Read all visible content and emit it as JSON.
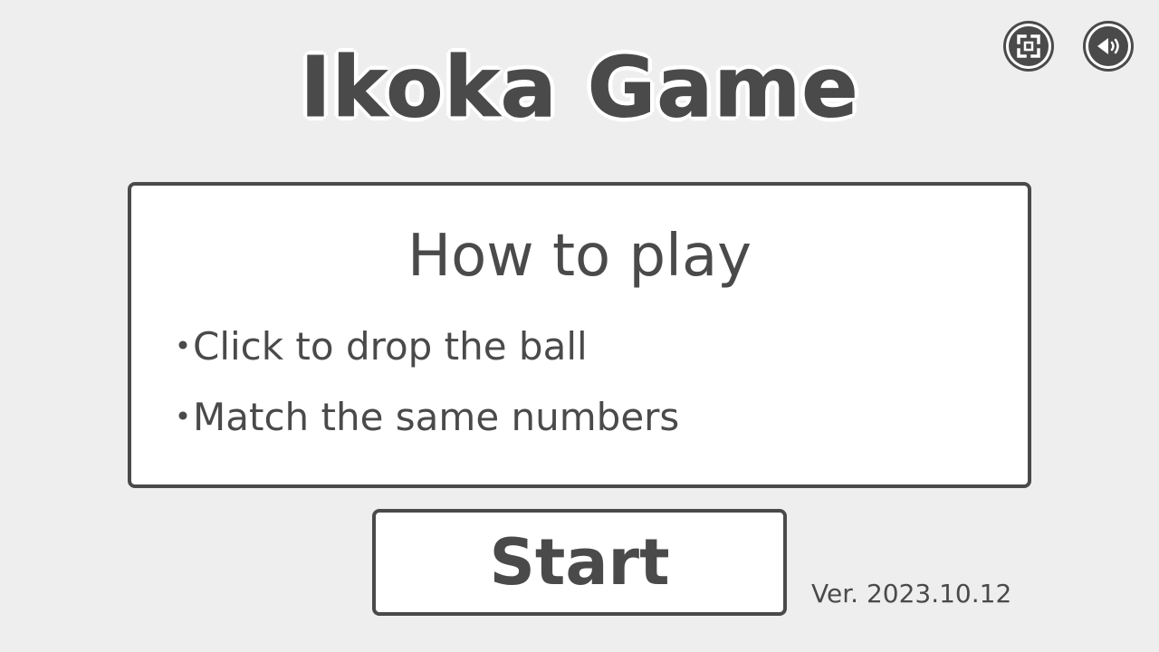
{
  "game": {
    "title": "Ikoka Game"
  },
  "controls": {
    "fullscreen_icon": "fullscreen-icon",
    "sound_icon": "sound-icon"
  },
  "howto": {
    "title": "How to play",
    "bullet": "・",
    "items": [
      "Click to drop the ball",
      "Match the same numbers"
    ]
  },
  "start": {
    "label": "Start"
  },
  "version": "Ver. 2023.10.12",
  "colors": {
    "background": "#eeeeee",
    "text": "#4a4a4a",
    "panel": "#ffffff"
  }
}
